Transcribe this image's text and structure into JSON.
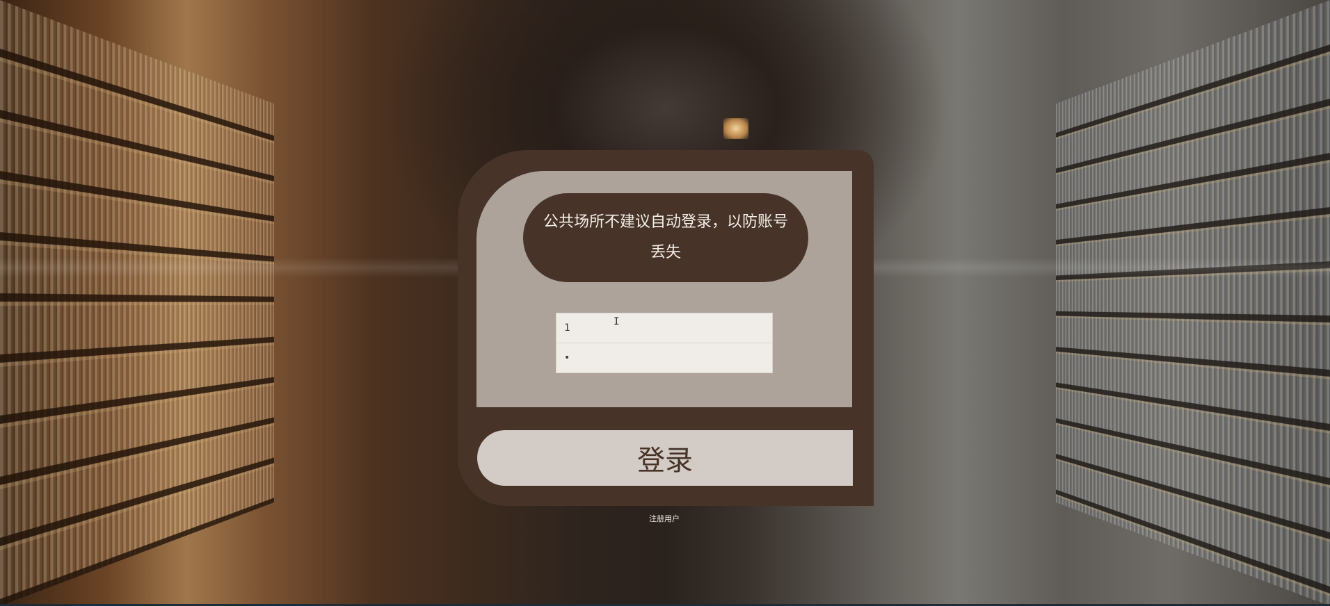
{
  "notice": {
    "text": "公共场所不建议自动登录，以防账号丢失"
  },
  "form": {
    "username_value": "1",
    "password_value": "•",
    "login_label": "登录",
    "register_label": "注册用户"
  },
  "colors": {
    "panel_brown": "#473328",
    "panel_light": "#ece8e2",
    "notice_text": "#f4efe8"
  }
}
